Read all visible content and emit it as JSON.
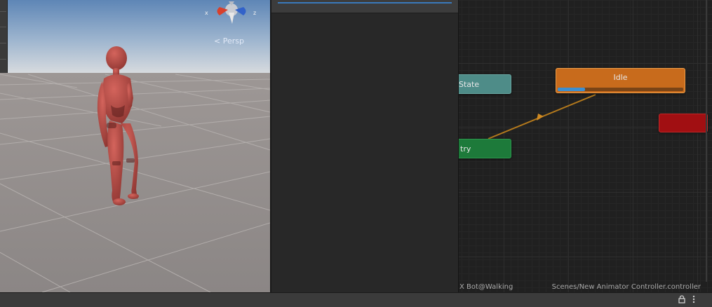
{
  "scene": {
    "gizmo_label": "< Persp",
    "axis_x": "x",
    "axis_z": "z"
  },
  "animator": {
    "nodes": {
      "any_state": "State",
      "entry": "try",
      "idle": "Idle",
      "exit": ""
    },
    "idle_progress": 0.22,
    "footer": {
      "clip": "X Bot@Walking",
      "controller_path": "Scenes/New Animator Controller.controller"
    }
  },
  "statusbar": {
    "lock_icon": "lock-icon",
    "menu_icon": "kebab-menu-icon"
  },
  "colors": {
    "idle_state": "#c86b1c",
    "entry_state": "#1d7a3a",
    "any_state": "#4e8c88",
    "exit_state": "#a10f12",
    "transition": "#c6821d",
    "accent_blue": "#3a79bb"
  }
}
